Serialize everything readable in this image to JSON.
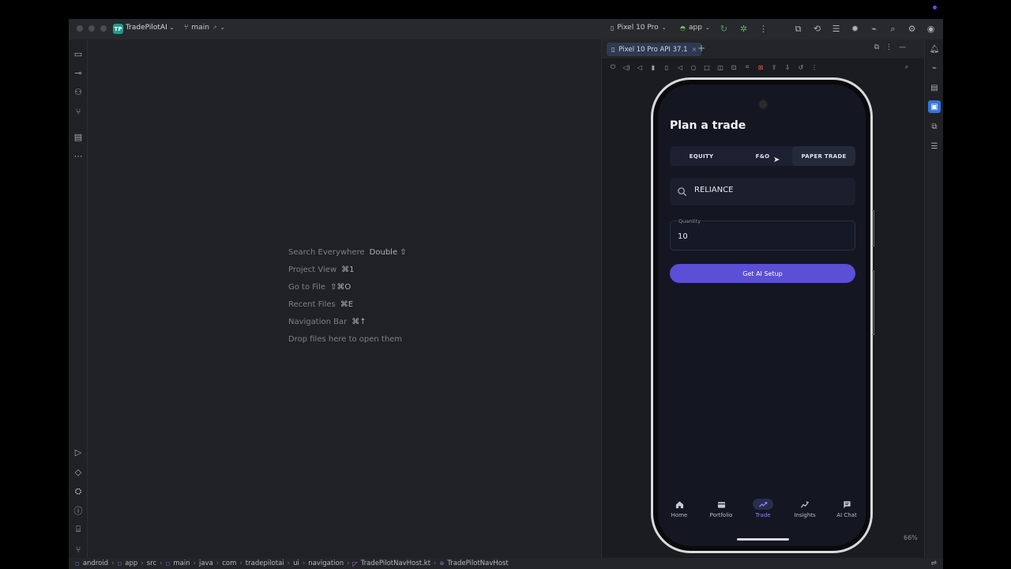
{
  "titlebar": {
    "project_badge": "TP",
    "project_name": "TradePilotAI",
    "branch": "main",
    "device": "Pixel 10 Pro",
    "run_config": "app"
  },
  "editor": {
    "hints": [
      {
        "label": "Search Everywhere",
        "key": "Double ⇧"
      },
      {
        "label": "Project View",
        "key": "⌘1"
      },
      {
        "label": "Go to File",
        "key": "⇧⌘O"
      },
      {
        "label": "Recent Files",
        "key": "⌘E"
      },
      {
        "label": "Navigation Bar",
        "key": "⌘↑"
      },
      {
        "label": "Drop files here to open them",
        "key": ""
      }
    ]
  },
  "running_devices": {
    "tab_label": "Pixel 10 Pro API 37.1",
    "zoom": "66%"
  },
  "app": {
    "title": "Plan a trade",
    "segments": [
      "EQUITY",
      "F&O",
      "PAPER TRADE"
    ],
    "active_segment": "PAPER TRADE",
    "search_value": "RELIANCE",
    "quantity_label": "Quantity",
    "quantity_value": "10",
    "cta_label": "Get AI Setup",
    "nav": [
      {
        "label": "Home",
        "icon": "home-icon"
      },
      {
        "label": "Portfolio",
        "icon": "wallet-icon"
      },
      {
        "label": "Trade",
        "icon": "trending-icon"
      },
      {
        "label": "Insights",
        "icon": "insights-icon"
      },
      {
        "label": "AI Chat",
        "icon": "chat-icon"
      }
    ],
    "active_nav": "Trade",
    "accent_color": "#5b4fd6"
  },
  "statusbar": {
    "path": [
      "android",
      "app",
      "src",
      "main",
      "java",
      "com",
      "tradepilotai",
      "ui",
      "navigation",
      "TradePilotNavHost.kt",
      "TradePilotNavHost"
    ]
  }
}
